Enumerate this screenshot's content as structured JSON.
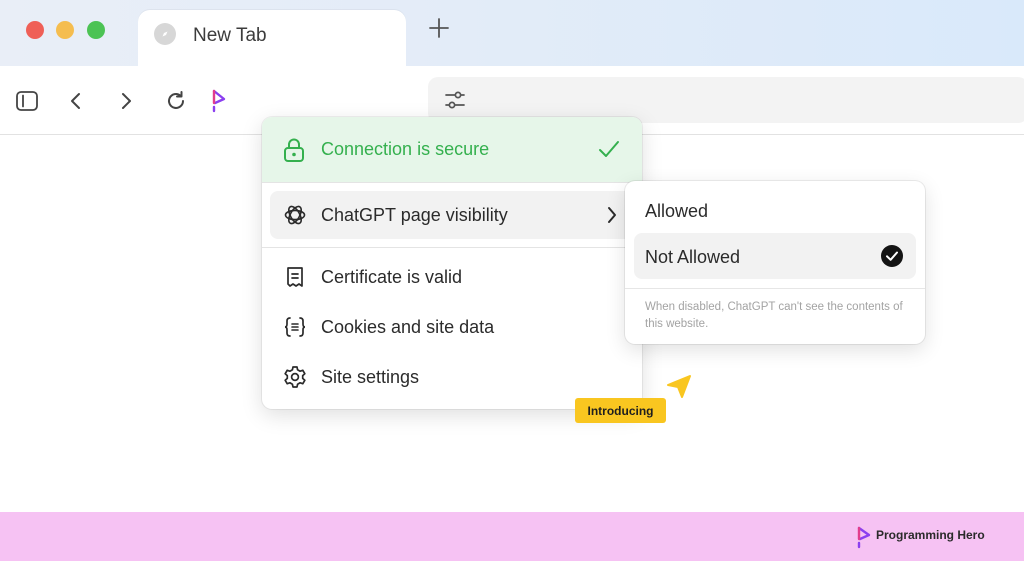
{
  "window": {
    "tab_title": "New Tab",
    "tab_icon": "compass-icon",
    "new_tab_icon": "plus-icon"
  },
  "toolbar": {
    "sidebar_icon": "sidebar-toggle-icon",
    "back_icon": "chevron-left-icon",
    "forward_icon": "chevron-right-icon",
    "reload_icon": "reload-icon",
    "extension_icon": "programming-hero-icon",
    "address_settings_icon": "sliders-icon"
  },
  "site_info": {
    "connection_label": "Connection is secure",
    "visibility_label": "ChatGPT page visibility",
    "items": [
      {
        "label": "Certificate is valid",
        "icon": "certificate-icon"
      },
      {
        "label": "Cookies and site data",
        "icon": "braces-icon"
      },
      {
        "label": "Site settings",
        "icon": "gear-icon"
      }
    ]
  },
  "visibility_menu": {
    "options": [
      {
        "label": "Allowed",
        "selected": false
      },
      {
        "label": "Not Allowed",
        "selected": true
      }
    ],
    "note": "When disabled, ChatGPT can't see the contents of this website."
  },
  "badge": {
    "label": "Introducing"
  },
  "footer": {
    "brand": "Programming Hero"
  },
  "colors": {
    "secure_green": "#34b04e",
    "secure_bg": "#e6f6e9",
    "badge_yellow": "#f9c620",
    "footer_pink": "#f6c2f3",
    "brand_purple": "#8b3ff0"
  }
}
